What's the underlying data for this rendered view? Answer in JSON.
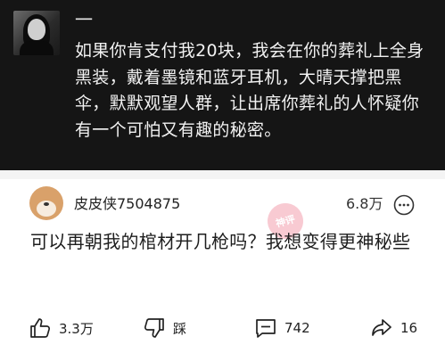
{
  "post": {
    "author_name": "一",
    "text": "如果你肯支付我20块，我会在你的葬礼上全身黑装，戴着墨镜和蓝牙耳机，大晴天撑把黑伞，默默观望人群，让出席你葬礼的人怀疑你有一个可怕又有趣的秘密。"
  },
  "comment": {
    "author": "皮皮侠7504875",
    "count": "6.8万",
    "text": "可以再朝我的棺材开几枪吗？我想变得更神秘些",
    "watermark_text": "神评"
  },
  "actions": {
    "like_count": "3.3万",
    "dislike_label": "踩",
    "reply_count": "742",
    "share_count": "16"
  },
  "icons": [
    "thumbs-up-icon",
    "thumbs-down-icon",
    "comment-icon",
    "share-icon",
    "more-icon"
  ],
  "colors": {
    "post_background": "#151515",
    "accent_watermark": "#f4a7b5"
  }
}
